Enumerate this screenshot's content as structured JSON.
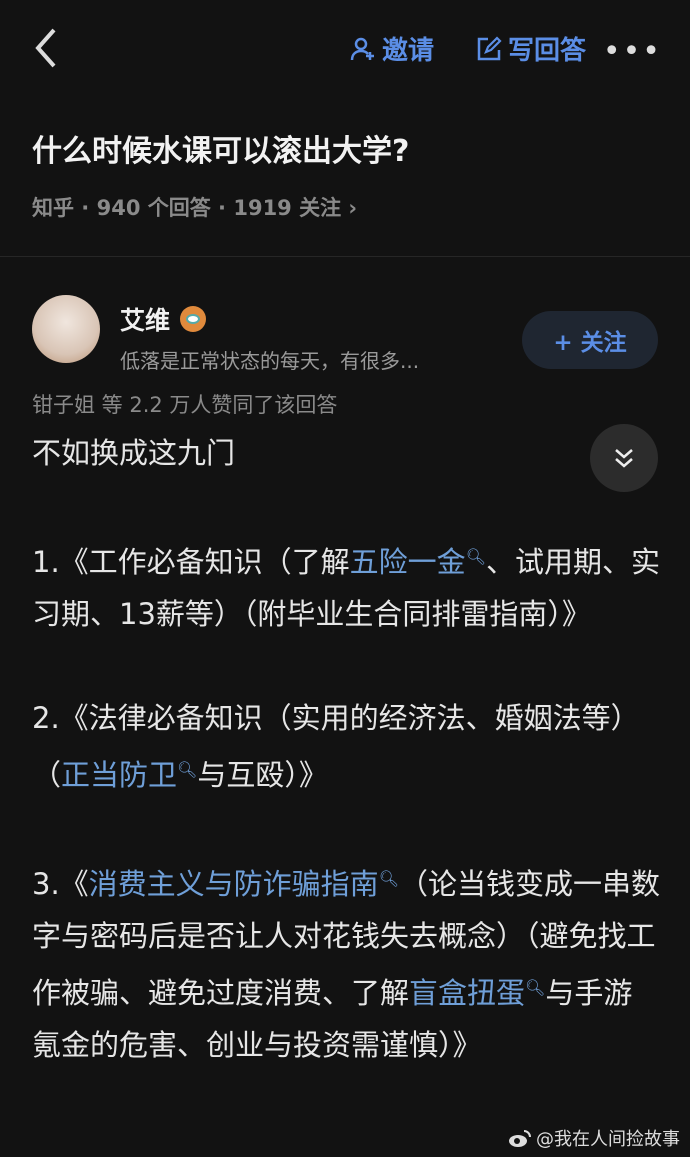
{
  "header": {
    "invite": "邀请",
    "write_answer": "写回答",
    "more": "•••"
  },
  "question": {
    "title": "什么时候水课可以滚出大学?",
    "meta": "知乎 · 940 个回答 · 1919 关注 ›"
  },
  "author": {
    "name": "艾维",
    "bio": "低落是正常状态的每天，有很多...",
    "follow": "+ 关注"
  },
  "votes": "钳子姐 等 2.2 万人赞同了该回答",
  "answer": {
    "intro": "不如换成这九门",
    "p1": [
      "1.《工作必备知识（了解",
      "五险一金",
      "、试用期、实习期、13薪等）（附毕业生合同排雷指南）》"
    ],
    "p2": [
      "2.《法律必备知识（实用的经济法、婚姻法等）（",
      "正当防卫",
      "与互殴）》"
    ],
    "p3": [
      "3.《",
      "消费主义与防诈骗指南",
      "（论当钱变成一串数字与密码后是否让人对花钱失去概念）（避免找工作被骗、避免过度消费、了解",
      "盲盒扭蛋",
      "与手游氪金的危害、创业与投资需谨慎）》"
    ]
  },
  "watermark": "@我在人间捡故事"
}
